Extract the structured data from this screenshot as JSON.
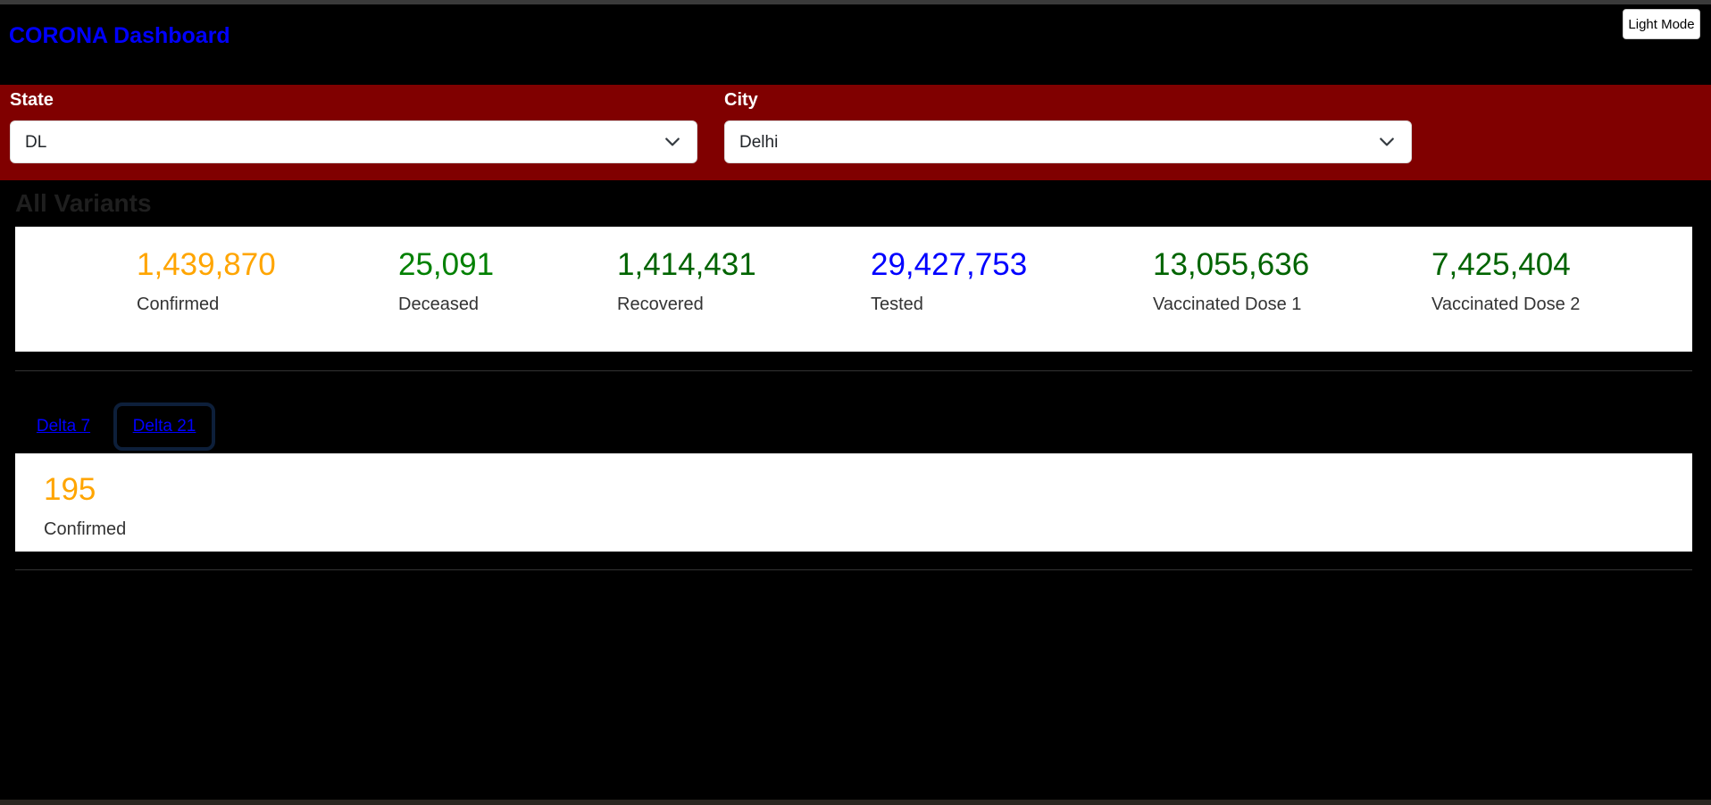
{
  "app": {
    "title": "CORONA Dashboard",
    "mode_button": "Light Mode"
  },
  "filters": {
    "state": {
      "label": "State",
      "value": "DL"
    },
    "city": {
      "label": "City",
      "value": "Delhi"
    }
  },
  "section_title": "All Variants",
  "stats": [
    {
      "value": "1,439,870",
      "label": "Confirmed",
      "color": "#ffa500"
    },
    {
      "value": "25,091",
      "label": "Deceased",
      "color": "#008000"
    },
    {
      "value": "1,414,431",
      "label": "Recovered",
      "color": "#006400"
    },
    {
      "value": "29,427,753",
      "label": "Tested",
      "color": "#0000ff"
    },
    {
      "value": "13,055,636",
      "label": "Vaccinated Dose 1",
      "color": "#006400"
    },
    {
      "value": "7,425,404",
      "label": "Vaccinated Dose 2",
      "color": "#006400"
    }
  ],
  "tabs": [
    {
      "label": "Delta 7",
      "active": false
    },
    {
      "label": "Delta 21",
      "active": true
    }
  ],
  "variant_stat": {
    "value": "195",
    "label": "Confirmed",
    "color": "#ffa500"
  }
}
